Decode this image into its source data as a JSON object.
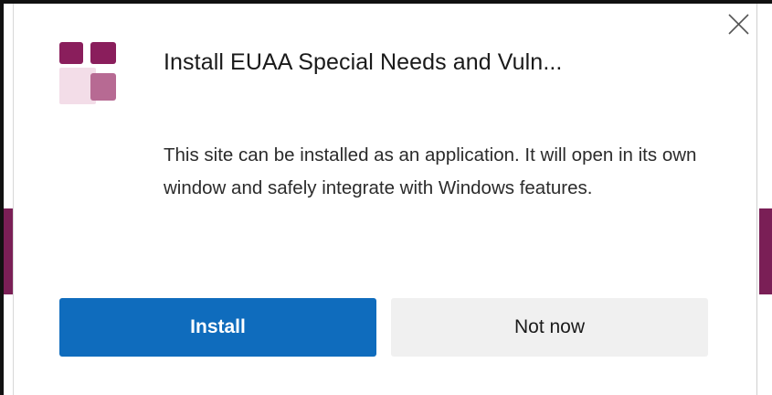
{
  "dialog": {
    "title": "Install EUAA Special Needs and Vuln...",
    "description": "This site can be installed as an application. It will open in its own window and safely integrate with Windows features.",
    "close_icon": "close-icon",
    "app_icon": "app-logo-icon"
  },
  "buttons": {
    "install_label": "Install",
    "not_now_label": "Not now"
  },
  "colors": {
    "primary": "#0f6cbd",
    "secondary_bg": "#f0f0f0",
    "brand": "#7a1f56"
  }
}
